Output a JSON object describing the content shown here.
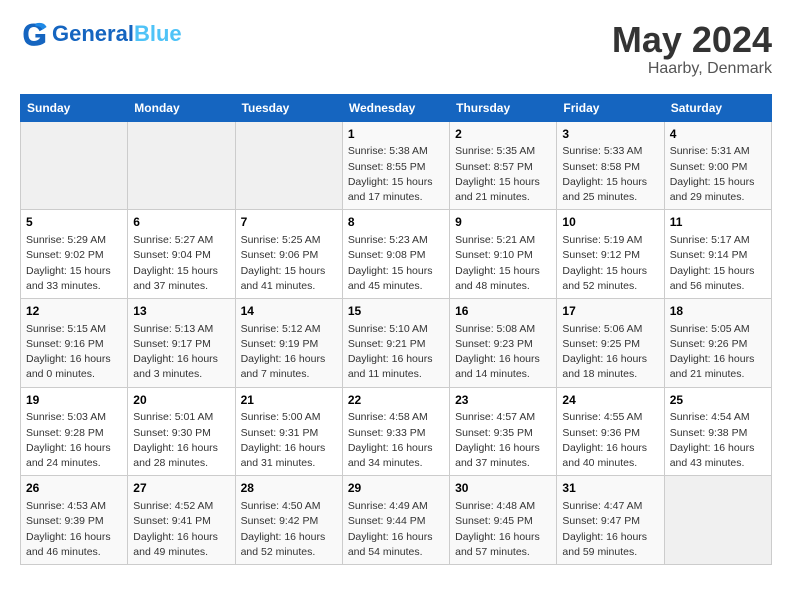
{
  "header": {
    "logo_general": "General",
    "logo_blue": "Blue",
    "main_title": "May 2024",
    "subtitle": "Haarby, Denmark"
  },
  "days_of_week": [
    "Sunday",
    "Monday",
    "Tuesday",
    "Wednesday",
    "Thursday",
    "Friday",
    "Saturday"
  ],
  "weeks": [
    [
      {
        "day": "",
        "info": ""
      },
      {
        "day": "",
        "info": ""
      },
      {
        "day": "",
        "info": ""
      },
      {
        "day": "1",
        "info": "Sunrise: 5:38 AM\nSunset: 8:55 PM\nDaylight: 15 hours\nand 17 minutes."
      },
      {
        "day": "2",
        "info": "Sunrise: 5:35 AM\nSunset: 8:57 PM\nDaylight: 15 hours\nand 21 minutes."
      },
      {
        "day": "3",
        "info": "Sunrise: 5:33 AM\nSunset: 8:58 PM\nDaylight: 15 hours\nand 25 minutes."
      },
      {
        "day": "4",
        "info": "Sunrise: 5:31 AM\nSunset: 9:00 PM\nDaylight: 15 hours\nand 29 minutes."
      }
    ],
    [
      {
        "day": "5",
        "info": "Sunrise: 5:29 AM\nSunset: 9:02 PM\nDaylight: 15 hours\nand 33 minutes."
      },
      {
        "day": "6",
        "info": "Sunrise: 5:27 AM\nSunset: 9:04 PM\nDaylight: 15 hours\nand 37 minutes."
      },
      {
        "day": "7",
        "info": "Sunrise: 5:25 AM\nSunset: 9:06 PM\nDaylight: 15 hours\nand 41 minutes."
      },
      {
        "day": "8",
        "info": "Sunrise: 5:23 AM\nSunset: 9:08 PM\nDaylight: 15 hours\nand 45 minutes."
      },
      {
        "day": "9",
        "info": "Sunrise: 5:21 AM\nSunset: 9:10 PM\nDaylight: 15 hours\nand 48 minutes."
      },
      {
        "day": "10",
        "info": "Sunrise: 5:19 AM\nSunset: 9:12 PM\nDaylight: 15 hours\nand 52 minutes."
      },
      {
        "day": "11",
        "info": "Sunrise: 5:17 AM\nSunset: 9:14 PM\nDaylight: 15 hours\nand 56 minutes."
      }
    ],
    [
      {
        "day": "12",
        "info": "Sunrise: 5:15 AM\nSunset: 9:16 PM\nDaylight: 16 hours\nand 0 minutes."
      },
      {
        "day": "13",
        "info": "Sunrise: 5:13 AM\nSunset: 9:17 PM\nDaylight: 16 hours\nand 3 minutes."
      },
      {
        "day": "14",
        "info": "Sunrise: 5:12 AM\nSunset: 9:19 PM\nDaylight: 16 hours\nand 7 minutes."
      },
      {
        "day": "15",
        "info": "Sunrise: 5:10 AM\nSunset: 9:21 PM\nDaylight: 16 hours\nand 11 minutes."
      },
      {
        "day": "16",
        "info": "Sunrise: 5:08 AM\nSunset: 9:23 PM\nDaylight: 16 hours\nand 14 minutes."
      },
      {
        "day": "17",
        "info": "Sunrise: 5:06 AM\nSunset: 9:25 PM\nDaylight: 16 hours\nand 18 minutes."
      },
      {
        "day": "18",
        "info": "Sunrise: 5:05 AM\nSunset: 9:26 PM\nDaylight: 16 hours\nand 21 minutes."
      }
    ],
    [
      {
        "day": "19",
        "info": "Sunrise: 5:03 AM\nSunset: 9:28 PM\nDaylight: 16 hours\nand 24 minutes."
      },
      {
        "day": "20",
        "info": "Sunrise: 5:01 AM\nSunset: 9:30 PM\nDaylight: 16 hours\nand 28 minutes."
      },
      {
        "day": "21",
        "info": "Sunrise: 5:00 AM\nSunset: 9:31 PM\nDaylight: 16 hours\nand 31 minutes."
      },
      {
        "day": "22",
        "info": "Sunrise: 4:58 AM\nSunset: 9:33 PM\nDaylight: 16 hours\nand 34 minutes."
      },
      {
        "day": "23",
        "info": "Sunrise: 4:57 AM\nSunset: 9:35 PM\nDaylight: 16 hours\nand 37 minutes."
      },
      {
        "day": "24",
        "info": "Sunrise: 4:55 AM\nSunset: 9:36 PM\nDaylight: 16 hours\nand 40 minutes."
      },
      {
        "day": "25",
        "info": "Sunrise: 4:54 AM\nSunset: 9:38 PM\nDaylight: 16 hours\nand 43 minutes."
      }
    ],
    [
      {
        "day": "26",
        "info": "Sunrise: 4:53 AM\nSunset: 9:39 PM\nDaylight: 16 hours\nand 46 minutes."
      },
      {
        "day": "27",
        "info": "Sunrise: 4:52 AM\nSunset: 9:41 PM\nDaylight: 16 hours\nand 49 minutes."
      },
      {
        "day": "28",
        "info": "Sunrise: 4:50 AM\nSunset: 9:42 PM\nDaylight: 16 hours\nand 52 minutes."
      },
      {
        "day": "29",
        "info": "Sunrise: 4:49 AM\nSunset: 9:44 PM\nDaylight: 16 hours\nand 54 minutes."
      },
      {
        "day": "30",
        "info": "Sunrise: 4:48 AM\nSunset: 9:45 PM\nDaylight: 16 hours\nand 57 minutes."
      },
      {
        "day": "31",
        "info": "Sunrise: 4:47 AM\nSunset: 9:47 PM\nDaylight: 16 hours\nand 59 minutes."
      },
      {
        "day": "",
        "info": ""
      }
    ]
  ]
}
